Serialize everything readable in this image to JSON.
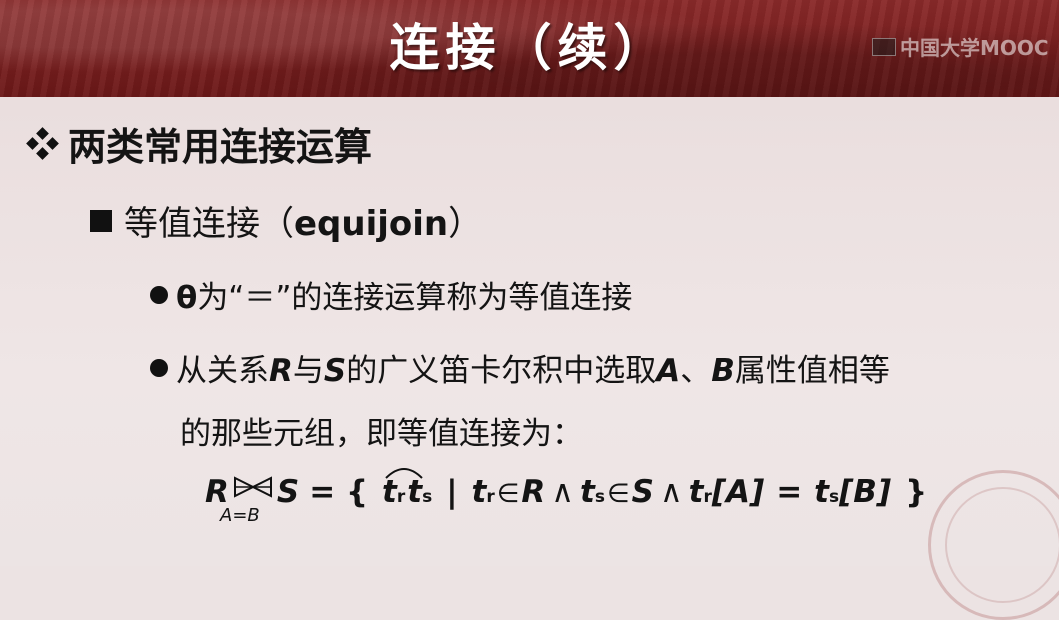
{
  "header": {
    "title": "连接（续）",
    "watermark": "中国大学MOOC",
    "background_color": "#7a1f1f"
  },
  "slide": {
    "bullet1": "两类常用连接运算",
    "bullet2_cn": "等值连接（",
    "bullet2_en": "equijoin",
    "bullet2_close": "）",
    "sub1_theta": "θ",
    "sub1_text": "为“＝”的连接运算称为等值连接",
    "sub2_a": "从关系",
    "sub2_R": "R",
    "sub2_b": "与",
    "sub2_S": "S",
    "sub2_c": "的广义笛卡尔积中选取",
    "sub2_A": "A",
    "sub2_d": "、",
    "sub2_B": "B",
    "sub2_e": "属性值相等",
    "sub2_line2": "的那些元组，即等值连接为：",
    "formula": {
      "left": "R",
      "right": "S",
      "condition": "A=B",
      "eq_open": "= {",
      "tr": "t",
      "r": "r",
      "ts": "t",
      "s": "s",
      "bar": "|",
      "in1": "∈",
      "Rrel": "R",
      "and1": "∧",
      "in2": "∈",
      "Srel": "S",
      "and2": "∧",
      "attrA": "[A]",
      "eq": "=",
      "attrB": "[B]",
      "close": "}"
    }
  }
}
